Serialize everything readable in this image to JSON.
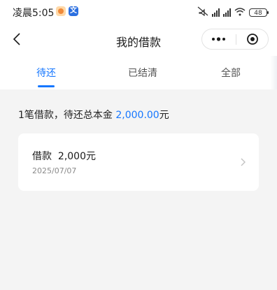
{
  "status_bar": {
    "time": "凌晨5:05",
    "app_badge": "文",
    "battery": "48"
  },
  "nav": {
    "title": "我的借款",
    "more_icon": "ellipsis-icon",
    "close_icon": "target-icon"
  },
  "tabs": [
    {
      "label": "待还",
      "active": true
    },
    {
      "label": "已结清",
      "active": false
    },
    {
      "label": "全部",
      "active": false
    }
  ],
  "summary": {
    "prefix": "1笔借款，待还总本金 ",
    "amount": "2,000.00",
    "suffix": "元"
  },
  "loans": [
    {
      "title_label": "借款",
      "amount": "2,000元",
      "date": "2025/07/07"
    }
  ],
  "colors": {
    "accent": "#1677ff",
    "background": "#f4f4f4"
  }
}
